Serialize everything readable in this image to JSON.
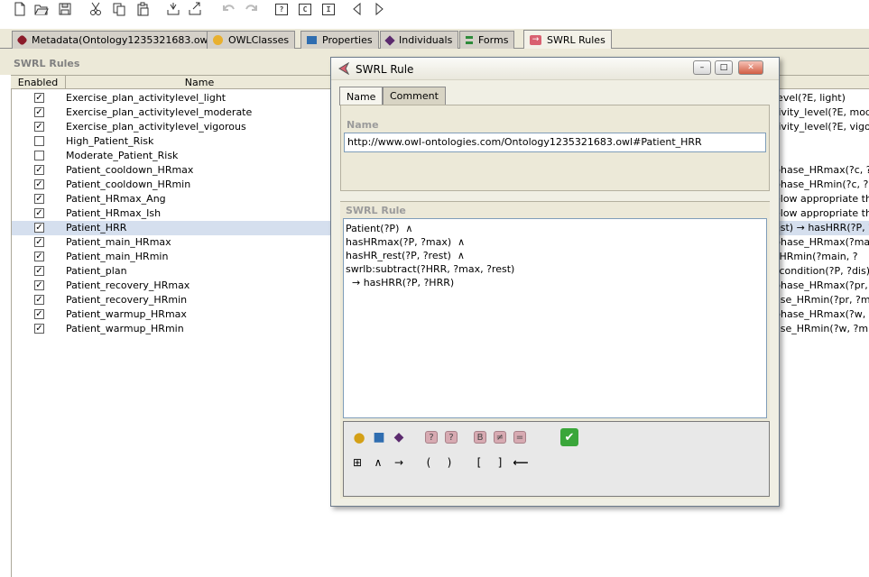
{
  "tabs": [
    {
      "label": "Metadata(Ontology1235321683.owl)",
      "icon": "metadata-icon",
      "color": "#8b1a2a"
    },
    {
      "label": "OWLClasses",
      "icon": "owl-class-icon",
      "color": "#e8b02f"
    },
    {
      "label": "Properties",
      "icon": "property-icon",
      "color": "#2f6db0"
    },
    {
      "label": "Individuals",
      "icon": "individual-icon",
      "color": "#5b2a6e"
    },
    {
      "label": "Forms",
      "icon": "forms-icon",
      "color": "#2e8b3a"
    },
    {
      "label": "SWRL Rules",
      "icon": "swrl-icon",
      "color": "#d96070"
    }
  ],
  "toolbar": {
    "query_label": "?",
    "class_label": "C",
    "instance_label": "I"
  },
  "panel": {
    "title": "SWRL Rules",
    "columns": {
      "enabled": "Enabled",
      "name": "Name"
    }
  },
  "rules": [
    {
      "enabled": true,
      "name": "Exercise_plan_activitylevel_light",
      "tail": "level(?E, light)",
      "selected": false
    },
    {
      "enabled": true,
      "name": "Exercise_plan_activitylevel_moderate",
      "tail": "tivity_level(?E, mode",
      "selected": false
    },
    {
      "enabled": true,
      "name": "Exercise_plan_activitylevel_vigorous",
      "tail": "tivity_level(?E, vigoro",
      "selected": false
    },
    {
      "enabled": false,
      "name": "High_Patient_Risk",
      "tail": "",
      "selected": false
    },
    {
      "enabled": false,
      "name": "Moderate_Patient_Risk",
      "tail": "",
      "selected": false
    },
    {
      "enabled": true,
      "name": "Patient_cooldown_HRmax",
      "tail": "phase_HRmax(?c, ?m",
      "selected": false
    },
    {
      "enabled": true,
      "name": "Patient_cooldown_HRmin",
      "tail": "phase_HRmin(?c, ?min",
      "selected": false
    },
    {
      "enabled": true,
      "name": "Patient_HRmax_Ang",
      "tail": "elow appropriate thre",
      "selected": false
    },
    {
      "enabled": true,
      "name": "Patient_HRmax_Ish",
      "tail": "elow appropriate thre",
      "selected": false
    },
    {
      "enabled": true,
      "name": "Patient_HRR",
      "tail": "est) → hasHRR(?P, ?",
      "selected": true
    },
    {
      "enabled": true,
      "name": "Patient_main_HRmax",
      "tail": "phase_HRmax(?main",
      "selected": false
    },
    {
      "enabled": true,
      "name": "Patient_main_HRmin",
      "tail": "_HRmin(?main, ?",
      "selected": false
    },
    {
      "enabled": true,
      "name": "Patient_plan",
      "tail": "_condition(?P, ?dis)",
      "selected": false
    },
    {
      "enabled": true,
      "name": "Patient_recovery_HRmax",
      "tail": "phase_HRmax(?pr, ?m",
      "selected": false
    },
    {
      "enabled": true,
      "name": "Patient_recovery_HRmin",
      "tail": "ase_HRmin(?pr, ?min",
      "selected": false
    },
    {
      "enabled": true,
      "name": "Patient_warmup_HRmax",
      "tail": "phase_HRmax(?w, ?",
      "selected": false
    },
    {
      "enabled": true,
      "name": "Patient_warmup_HRmin",
      "tail": "ase_HRmin(?w, ?mi",
      "selected": false
    }
  ],
  "dialog": {
    "title": "SWRL Rule",
    "tabs": [
      "Name",
      "Comment"
    ],
    "name_label": "Name",
    "name_value": "http://www.owl-ontologies.com/Ontology1235321683.owl#Patient_HRR",
    "rule_label": "SWRL Rule",
    "rule_lines": [
      "Patient(?P)  ∧",
      "hasHRmax(?P, ?max)  ∧",
      "hasHR_rest(?P, ?rest)  ∧",
      "swrlb:subtract(?HRR, ?max, ?rest)",
      "  → hasHRR(?P, ?HRR)"
    ],
    "window_buttons": {
      "minimize": "–",
      "maximize": "□",
      "close": "✕"
    }
  },
  "palette": {
    "row1": [
      {
        "icon": "insert-class-icon",
        "glyph": "●",
        "color": "#d4a017"
      },
      {
        "icon": "insert-property-icon",
        "glyph": "■",
        "color": "#2f6db0"
      },
      {
        "icon": "insert-individual-icon",
        "glyph": "◆",
        "color": "#5b2a6e"
      },
      {
        "icon": "insert-variable-icon",
        "glyph": "?"
      },
      {
        "icon": "insert-new-variable-icon",
        "glyph": "?"
      },
      {
        "icon": "insert-builtin-icon",
        "glyph": "B"
      },
      {
        "icon": "insert-different-from-icon",
        "glyph": "≠"
      },
      {
        "icon": "insert-same-as-icon",
        "glyph": "="
      },
      {
        "icon": "validate-ok-icon",
        "glyph": "✔",
        "color": "#3aa63a"
      }
    ],
    "row2": [
      {
        "icon": "insert-grid-icon",
        "glyph": "⊞"
      },
      {
        "icon": "insert-and-icon",
        "glyph": "∧"
      },
      {
        "icon": "insert-implies-icon",
        "glyph": "→"
      },
      {
        "icon": "insert-open-paren-icon",
        "glyph": "("
      },
      {
        "icon": "insert-close-paren-icon",
        "glyph": ")"
      },
      {
        "icon": "insert-open-bracket-icon",
        "glyph": "["
      },
      {
        "icon": "insert-close-bracket-icon",
        "glyph": "]"
      },
      {
        "icon": "backspace-icon",
        "glyph": "⟵"
      }
    ]
  }
}
